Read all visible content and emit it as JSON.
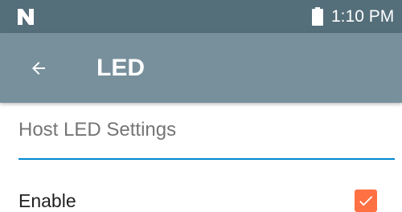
{
  "status_bar": {
    "time": "1:10 PM",
    "notification_icon": "n-notification-icon",
    "battery_icon": "battery-full-icon",
    "background_color": "#546e7a"
  },
  "app_bar": {
    "title": "LED",
    "back_icon": "arrow-back-icon",
    "background_color": "#78909c"
  },
  "section": {
    "header": "Host LED Settings",
    "divider_color": "#0288d1"
  },
  "preferences": [
    {
      "label": "Enable",
      "checked": true,
      "checkbox_color": "#ff7043"
    }
  ]
}
